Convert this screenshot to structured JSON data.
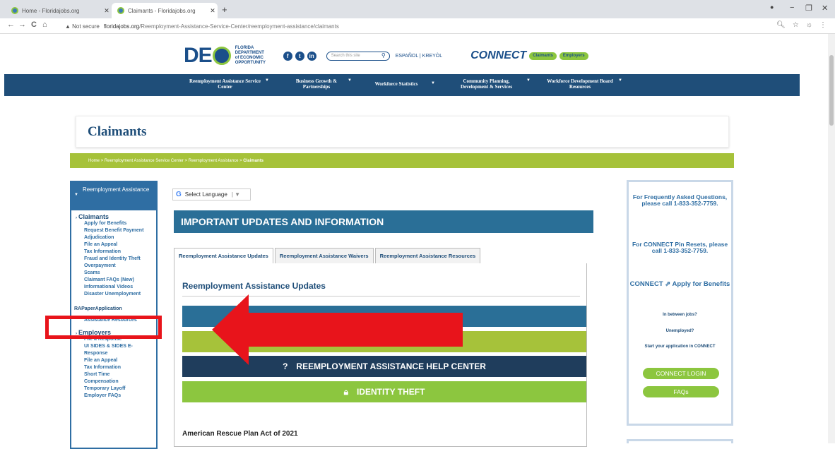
{
  "browser": {
    "tabs": [
      {
        "label": "Home - Floridajobs.org",
        "active": false
      },
      {
        "label": "Claimants - Floridajobs.org",
        "active": true
      }
    ],
    "new_tab": "+",
    "win_min": "−",
    "win_max": "❐",
    "win_close": "✕",
    "back": "←",
    "forward": "→",
    "reload": "C",
    "home": "⌂",
    "not_secure": "▲ Not secure",
    "url_domain": "floridajobs.org",
    "url_path": "/Reemployment-Assistance-Service-Center/reemployment-assistance/claimants"
  },
  "header": {
    "logo_text": "DE",
    "logo_sub": "FLORIDA DEPARTMENT of ECONOMIC OPPORTUNITY",
    "social": [
      "f",
      "t",
      "in"
    ],
    "search_placeholder": "Search this site",
    "languages": "ESPAÑOL | KREYÒL",
    "connect_logo": "CONNECT",
    "connect_pills": [
      "Claimants",
      "Employers"
    ]
  },
  "nav": [
    {
      "label": "Reemployment Assistance Service Center"
    },
    {
      "label": "Business Growth & Partnerships"
    },
    {
      "label": "Workforce Statistics"
    },
    {
      "label": "Community Planning, Development & Services"
    },
    {
      "label": "Workforce Development Board Resources"
    }
  ],
  "page": {
    "title": "Claimants",
    "breadcrumb": "Home  >  Reemployment Assistance Service Center  >  Reemployment Assistance  >",
    "breadcrumb_current": "Claimants"
  },
  "sidebar": {
    "header": "Reemployment Assistance",
    "claimants_title": "Claimants",
    "claimants_items": [
      "Apply for Benefits",
      "Request Benefit Payment",
      "Adjudication",
      "File an Appeal",
      "Tax Information",
      "Fraud and Identity Theft",
      "Overpayment",
      "Scams",
      "Claimant FAQs (New)",
      "Informational Videos",
      "Disaster Unemployment",
      "",
      "RAPaperApplication",
      "",
      "Assistance Resources"
    ],
    "employers_title": "Employers",
    "employers_items": [
      "File a Response",
      "UI SIDES & SIDES E-Response",
      "File an Appeal",
      "Tax Information",
      "Short Time Compensation",
      "Temporary Layoff",
      "Employer FAQs"
    ]
  },
  "translate": {
    "label": "Select Language"
  },
  "main": {
    "important_header": "IMPORTANT UPDATES AND INFORMATION",
    "tabs": [
      "Reemployment Assistance Updates",
      "Reemployment Assistance Waivers",
      "Reemployment Assistance Resources"
    ],
    "panel_heading": "Reemployment Assistance Updates",
    "help_center": "REEMPLOYMENT ASSISTANCE HELP CENTER",
    "identity_theft": "IDENTITY THEFT",
    "arp_heading": "American Rescue Plan Act of 2021"
  },
  "right": {
    "faq_call": "For Frequently Asked Questions, please call 1-833-352-7759.",
    "pin_call": "For CONNECT Pin Resets, please call 1-833-352-7759.",
    "connect_apply": "CONNECT ⇗ Apply for Benefits",
    "between_jobs": "In between jobs?",
    "unemployed": "Unemployed?",
    "start_app": "Start your application in CONNECT",
    "login_btn": "CONNECT LOGIN",
    "faqs_btn": "FAQs"
  },
  "colors": {
    "navy": "#1f4e79",
    "green": "#8cc63f",
    "annotation_red": "#e8141b"
  }
}
